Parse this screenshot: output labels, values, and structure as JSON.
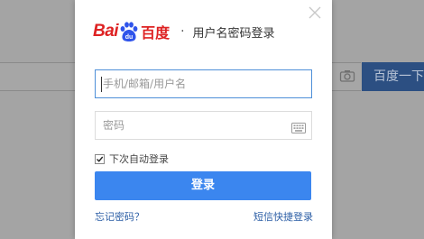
{
  "background": {
    "search_button_label": "百度一下"
  },
  "dialog": {
    "logo": {
      "text_bai": "Bai",
      "text_du": "du",
      "text_cn": "百度",
      "brand_color": "#de2223"
    },
    "separator": "·",
    "title": "用户名密码登录",
    "username": {
      "placeholder": "手机/邮箱/用户名",
      "value": ""
    },
    "password": {
      "placeholder": "密码",
      "value": ""
    },
    "remember": {
      "label": "下次自动登录",
      "checked": true
    },
    "login_button_label": "登录",
    "forgot_password_label": "忘记密码？",
    "sms_login_label": "短信快捷登录",
    "colors": {
      "primary_button": "#3b86ef",
      "link": "#2d5fa6",
      "focus_border": "#4e8fd8"
    }
  }
}
